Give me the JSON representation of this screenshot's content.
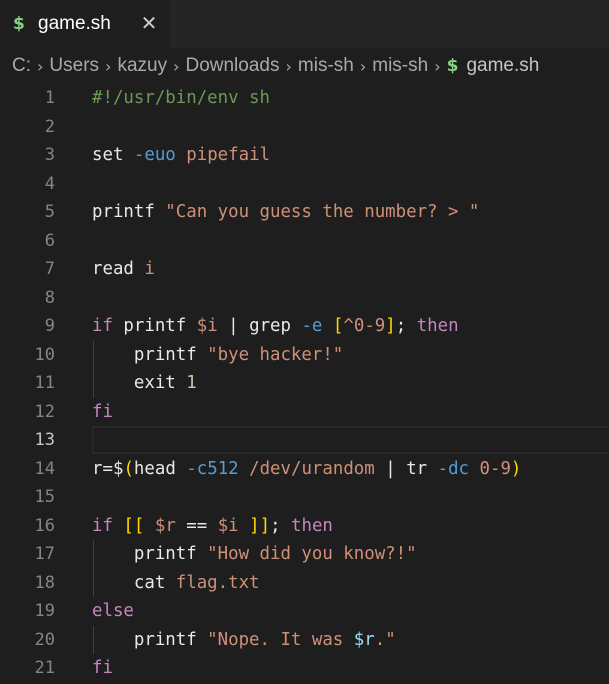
{
  "tab": {
    "icon": "$",
    "label": "game.sh",
    "close": "✕"
  },
  "breadcrumb": {
    "items": [
      "C:",
      "Users",
      "kazuy",
      "Downloads",
      "mis-sh",
      "mis-sh"
    ],
    "separator": "›",
    "file_icon": "$",
    "file": "game.sh"
  },
  "editor": {
    "active_line": 13,
    "lines": [
      {
        "n": "1",
        "tokens": [
          {
            "t": "#!/usr/bin/env sh",
            "c": "cmt"
          }
        ]
      },
      {
        "n": "2",
        "tokens": []
      },
      {
        "n": "3",
        "tokens": [
          {
            "t": "set ",
            "c": "plain"
          },
          {
            "t": "-euo",
            "c": "flag"
          },
          {
            "t": " pipefail",
            "c": "str"
          }
        ]
      },
      {
        "n": "4",
        "tokens": []
      },
      {
        "n": "5",
        "tokens": [
          {
            "t": "printf ",
            "c": "plain"
          },
          {
            "t": "\"Can you guess the number? > \"",
            "c": "str"
          }
        ]
      },
      {
        "n": "6",
        "tokens": []
      },
      {
        "n": "7",
        "tokens": [
          {
            "t": "read ",
            "c": "plain"
          },
          {
            "t": "i",
            "c": "str"
          }
        ]
      },
      {
        "n": "8",
        "tokens": []
      },
      {
        "n": "9",
        "tokens": [
          {
            "t": "if ",
            "c": "kw"
          },
          {
            "t": "printf ",
            "c": "plain"
          },
          {
            "t": "$i",
            "c": "str"
          },
          {
            "t": " | ",
            "c": "plain"
          },
          {
            "t": "grep ",
            "c": "plain"
          },
          {
            "t": "-e",
            "c": "flag"
          },
          {
            "t": " ",
            "c": "plain"
          },
          {
            "t": "[",
            "c": "br1"
          },
          {
            "t": "^0-9",
            "c": "str"
          },
          {
            "t": "]",
            "c": "br1"
          },
          {
            "t": "; ",
            "c": "plain"
          },
          {
            "t": "then",
            "c": "kw"
          }
        ]
      },
      {
        "n": "10",
        "tokens": [
          {
            "t": "    printf ",
            "c": "plain"
          },
          {
            "t": "\"bye hacker!\"",
            "c": "str"
          }
        ]
      },
      {
        "n": "11",
        "tokens": [
          {
            "t": "    exit ",
            "c": "plain"
          },
          {
            "t": "1",
            "c": "num"
          }
        ]
      },
      {
        "n": "12",
        "tokens": [
          {
            "t": "fi",
            "c": "kw"
          }
        ]
      },
      {
        "n": "13",
        "tokens": []
      },
      {
        "n": "14",
        "tokens": [
          {
            "t": "r=",
            "c": "plain"
          },
          {
            "t": "$",
            "c": "plain"
          },
          {
            "t": "(",
            "c": "br1"
          },
          {
            "t": "head ",
            "c": "plain"
          },
          {
            "t": "-c512",
            "c": "flag"
          },
          {
            "t": " /dev/urandom",
            "c": "str"
          },
          {
            "t": " | ",
            "c": "plain"
          },
          {
            "t": "tr ",
            "c": "plain"
          },
          {
            "t": "-dc",
            "c": "flag"
          },
          {
            "t": " 0-9",
            "c": "str"
          },
          {
            "t": ")",
            "c": "br1"
          }
        ]
      },
      {
        "n": "15",
        "tokens": []
      },
      {
        "n": "16",
        "tokens": [
          {
            "t": "if ",
            "c": "kw"
          },
          {
            "t": "[[",
            "c": "br1"
          },
          {
            "t": " $r ",
            "c": "str"
          },
          {
            "t": "==",
            "c": "plain"
          },
          {
            "t": " $i ",
            "c": "str"
          },
          {
            "t": "]]",
            "c": "br1"
          },
          {
            "t": "; ",
            "c": "plain"
          },
          {
            "t": "then",
            "c": "kw"
          }
        ]
      },
      {
        "n": "17",
        "tokens": [
          {
            "t": "    printf ",
            "c": "plain"
          },
          {
            "t": "\"How did you know?!\"",
            "c": "str"
          }
        ]
      },
      {
        "n": "18",
        "tokens": [
          {
            "t": "    cat ",
            "c": "plain"
          },
          {
            "t": "flag.txt",
            "c": "str"
          }
        ]
      },
      {
        "n": "19",
        "tokens": [
          {
            "t": "else",
            "c": "kw"
          }
        ]
      },
      {
        "n": "20",
        "tokens": [
          {
            "t": "    printf ",
            "c": "plain"
          },
          {
            "t": "\"Nope. It was ",
            "c": "str"
          },
          {
            "t": "$r",
            "c": "var"
          },
          {
            "t": ".\"",
            "c": "str"
          }
        ]
      },
      {
        "n": "21",
        "tokens": [
          {
            "t": "fi",
            "c": "kw"
          }
        ]
      }
    ]
  },
  "colors": {
    "background": "#1e1e1e",
    "tabbar": "#252526",
    "shell_icon": "#89d185",
    "keyword": "#c586c0",
    "string": "#ce9178",
    "flag": "#569cd6",
    "comment": "#6a9955",
    "number": "#b5cea8",
    "bracket": "#ffd700"
  }
}
